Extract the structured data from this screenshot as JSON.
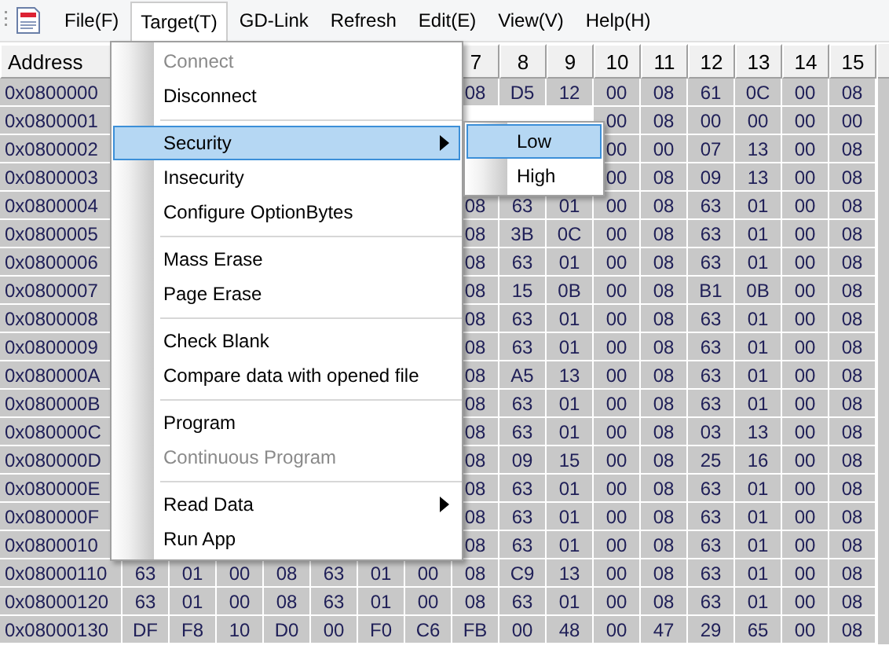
{
  "menubar": {
    "items": [
      {
        "label": "File(F)",
        "selected": false
      },
      {
        "label": "Target(T)",
        "selected": true
      },
      {
        "label": "GD-Link",
        "selected": false
      },
      {
        "label": "Refresh",
        "selected": false
      },
      {
        "label": "Edit(E)",
        "selected": false
      },
      {
        "label": "View(V)",
        "selected": false
      },
      {
        "label": "Help(H)",
        "selected": false
      }
    ]
  },
  "table": {
    "columns": [
      "Address",
      null,
      null,
      null,
      null,
      null,
      null,
      null,
      "7",
      "8",
      "9",
      "10",
      "11",
      "12",
      "13",
      "14",
      "15"
    ],
    "rows": [
      {
        "cells": [
          "0x0800000",
          null,
          null,
          null,
          null,
          null,
          null,
          null,
          "08",
          "D5",
          "12",
          "00",
          "08",
          "61",
          "0C",
          "00",
          "08"
        ]
      },
      {
        "cells": [
          "0x0800001",
          null,
          null,
          null,
          null,
          null,
          null,
          null,
          null,
          null,
          null,
          "00",
          "08",
          "00",
          "00",
          "00",
          "00"
        ]
      },
      {
        "cells": [
          "0x0800002",
          null,
          null,
          null,
          null,
          null,
          null,
          null,
          null,
          null,
          null,
          "00",
          "00",
          "07",
          "13",
          "00",
          "08"
        ]
      },
      {
        "cells": [
          "0x0800003",
          null,
          null,
          null,
          null,
          null,
          null,
          null,
          null,
          null,
          null,
          "00",
          "08",
          "09",
          "13",
          "00",
          "08"
        ]
      },
      {
        "cells": [
          "0x0800004",
          null,
          null,
          null,
          null,
          null,
          null,
          null,
          "08",
          "63",
          "01",
          "00",
          "08",
          "63",
          "01",
          "00",
          "08"
        ]
      },
      {
        "cells": [
          "0x0800005",
          null,
          null,
          null,
          null,
          null,
          null,
          null,
          "08",
          "3B",
          "0C",
          "00",
          "08",
          "63",
          "01",
          "00",
          "08"
        ]
      },
      {
        "cells": [
          "0x0800006",
          null,
          null,
          null,
          null,
          null,
          null,
          null,
          "08",
          "63",
          "01",
          "00",
          "08",
          "63",
          "01",
          "00",
          "08"
        ]
      },
      {
        "cells": [
          "0x0800007",
          null,
          null,
          null,
          null,
          null,
          null,
          null,
          "08",
          "15",
          "0B",
          "00",
          "08",
          "B1",
          "0B",
          "00",
          "08"
        ]
      },
      {
        "cells": [
          "0x0800008",
          null,
          null,
          null,
          null,
          null,
          null,
          null,
          "08",
          "63",
          "01",
          "00",
          "08",
          "63",
          "01",
          "00",
          "08"
        ]
      },
      {
        "cells": [
          "0x0800009",
          null,
          null,
          null,
          null,
          null,
          null,
          null,
          "08",
          "63",
          "01",
          "00",
          "08",
          "63",
          "01",
          "00",
          "08"
        ]
      },
      {
        "cells": [
          "0x080000A",
          null,
          null,
          null,
          null,
          null,
          null,
          null,
          "08",
          "A5",
          "13",
          "00",
          "08",
          "63",
          "01",
          "00",
          "08"
        ]
      },
      {
        "cells": [
          "0x080000B",
          null,
          null,
          null,
          null,
          null,
          null,
          null,
          "08",
          "63",
          "01",
          "00",
          "08",
          "63",
          "01",
          "00",
          "08"
        ]
      },
      {
        "cells": [
          "0x080000C",
          null,
          null,
          null,
          null,
          null,
          null,
          null,
          "08",
          "63",
          "01",
          "00",
          "08",
          "03",
          "13",
          "00",
          "08"
        ]
      },
      {
        "cells": [
          "0x080000D",
          null,
          null,
          null,
          null,
          null,
          null,
          null,
          "08",
          "09",
          "15",
          "00",
          "08",
          "25",
          "16",
          "00",
          "08"
        ]
      },
      {
        "cells": [
          "0x080000E",
          null,
          null,
          null,
          null,
          null,
          null,
          null,
          "08",
          "63",
          "01",
          "00",
          "08",
          "63",
          "01",
          "00",
          "08"
        ]
      },
      {
        "cells": [
          "0x080000F",
          null,
          null,
          null,
          null,
          null,
          null,
          null,
          "08",
          "63",
          "01",
          "00",
          "08",
          "63",
          "01",
          "00",
          "08"
        ]
      },
      {
        "cells": [
          "0x0800010",
          null,
          null,
          null,
          null,
          null,
          null,
          null,
          "08",
          "63",
          "01",
          "00",
          "08",
          "63",
          "01",
          "00",
          "08"
        ]
      },
      {
        "cells": [
          "0x08000110",
          "63",
          "01",
          "00",
          "08",
          "63",
          "01",
          "00",
          "08",
          "C9",
          "13",
          "00",
          "08",
          "63",
          "01",
          "00",
          "08"
        ]
      },
      {
        "cells": [
          "0x08000120",
          "63",
          "01",
          "00",
          "08",
          "63",
          "01",
          "00",
          "08",
          "63",
          "01",
          "00",
          "08",
          "63",
          "01",
          "00",
          "08"
        ]
      },
      {
        "cells": [
          "0x08000130",
          "DF",
          "F8",
          "10",
          "D0",
          "00",
          "F0",
          "C6",
          "FB",
          "00",
          "48",
          "00",
          "47",
          "29",
          "65",
          "00",
          "08"
        ]
      }
    ]
  },
  "menu": {
    "items": [
      {
        "kind": "item",
        "label": "Connect",
        "disabled": true,
        "selected": false,
        "submenu": false
      },
      {
        "kind": "item",
        "label": "Disconnect",
        "disabled": false,
        "selected": false,
        "submenu": false
      },
      {
        "kind": "separator"
      },
      {
        "kind": "item",
        "label": "Security",
        "disabled": false,
        "selected": true,
        "submenu": true
      },
      {
        "kind": "item",
        "label": "Insecurity",
        "disabled": false,
        "selected": false,
        "submenu": false
      },
      {
        "kind": "item",
        "label": "Configure OptionBytes",
        "disabled": false,
        "selected": false,
        "submenu": false
      },
      {
        "kind": "separator"
      },
      {
        "kind": "item",
        "label": "Mass Erase",
        "disabled": false,
        "selected": false,
        "submenu": false
      },
      {
        "kind": "item",
        "label": "Page Erase",
        "disabled": false,
        "selected": false,
        "submenu": false
      },
      {
        "kind": "separator"
      },
      {
        "kind": "item",
        "label": "Check Blank",
        "disabled": false,
        "selected": false,
        "submenu": false
      },
      {
        "kind": "item",
        "label": "Compare data with opened file",
        "disabled": false,
        "selected": false,
        "submenu": false
      },
      {
        "kind": "separator"
      },
      {
        "kind": "item",
        "label": "Program",
        "disabled": false,
        "selected": false,
        "submenu": false
      },
      {
        "kind": "item",
        "label": "Continuous Program",
        "disabled": true,
        "selected": false,
        "submenu": false
      },
      {
        "kind": "separator"
      },
      {
        "kind": "item",
        "label": "Read Data",
        "disabled": false,
        "selected": false,
        "submenu": true
      },
      {
        "kind": "item",
        "label": "Run App",
        "disabled": false,
        "selected": false,
        "submenu": false
      }
    ]
  },
  "submenu": {
    "items": [
      {
        "label": "Low",
        "selected": true
      },
      {
        "label": "High",
        "selected": false
      }
    ]
  }
}
